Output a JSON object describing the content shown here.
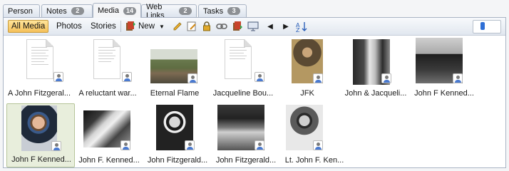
{
  "tabs": [
    {
      "label": "Person",
      "badge": ""
    },
    {
      "label": "Notes",
      "badge": "2"
    },
    {
      "label": "Media",
      "badge": "14"
    },
    {
      "label": "Web Links",
      "badge": "2"
    },
    {
      "label": "Tasks",
      "badge": "3"
    }
  ],
  "toolbar": {
    "all_media": "All Media",
    "photos": "Photos",
    "stories": "Stories",
    "new": "New",
    "icons": [
      "new-media-icon",
      "dropdown-arrow-icon",
      "pencil-icon",
      "edit-properties-icon",
      "lock-icon",
      "link-icon",
      "book-icon",
      "slideshow-icon",
      "previous-icon",
      "next-icon",
      "sort-icon"
    ]
  },
  "zoom_level": 0.3,
  "media": [
    {
      "caption": "A John Fitzgeral...",
      "kind": "document",
      "selected": false
    },
    {
      "caption": "A reluctant war...",
      "kind": "document",
      "selected": false
    },
    {
      "caption": "Eternal Flame",
      "kind": "photo",
      "selected": false
    },
    {
      "caption": "Jacqueline Bou...",
      "kind": "document",
      "selected": false
    },
    {
      "caption": "JFK",
      "kind": "photo",
      "selected": false
    },
    {
      "caption": "John & Jacqueli...",
      "kind": "photo",
      "selected": false
    },
    {
      "caption": "John F Kenned...",
      "kind": "photo",
      "selected": false
    },
    {
      "caption": "John F Kenned...",
      "kind": "photo",
      "selected": true
    },
    {
      "caption": "John F. Kenned...",
      "kind": "photo",
      "selected": false
    },
    {
      "caption": "John Fitzgerald...",
      "kind": "photo",
      "selected": false
    },
    {
      "caption": "John Fitzgerald...",
      "kind": "photo",
      "selected": false
    },
    {
      "caption": "Lt. John F. Ken...",
      "kind": "photo",
      "selected": false
    }
  ]
}
